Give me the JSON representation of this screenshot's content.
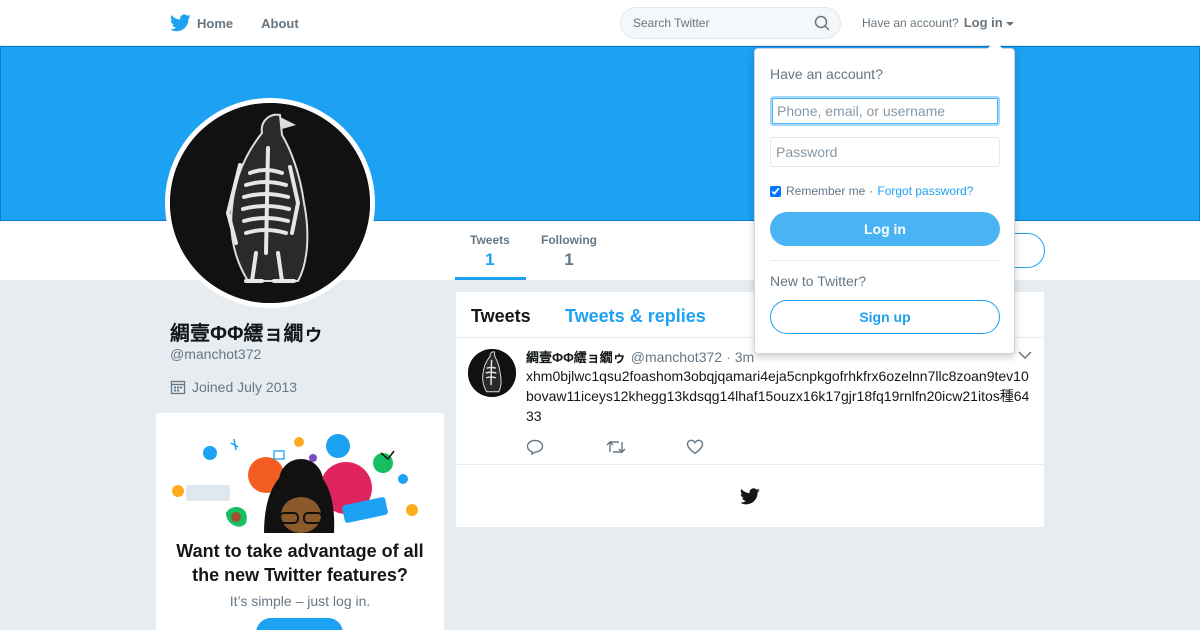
{
  "nav": {
    "home_label": "Home",
    "about_label": "About",
    "search_placeholder": "Search Twitter",
    "account_prompt": "Have an account?",
    "login_label": "Log in"
  },
  "profile": {
    "name": "綢壹ФΦ繧ョ繝ゥ",
    "handle": "@manchot372",
    "joined": "Joined July 2013",
    "stats": [
      {
        "label": "Tweets",
        "value": "1"
      },
      {
        "label": "Following",
        "value": "1"
      }
    ]
  },
  "promo": {
    "title": "Want to take advantage of all the new Twitter features?",
    "subtitle": "It’s simple – just log in."
  },
  "timeline": {
    "tabs": [
      "Tweets",
      "Tweets & replies"
    ],
    "tweet": {
      "name": "綢壹ФΦ繧ョ繝ゥ",
      "handle": "@manchot372",
      "time": "3m",
      "text": "xhm0bjlwc1qsu2foashom3obqjqamari4eja5cnpkgofrhkfrx6ozelnn7llc8zoan9tev10bovaw11iceys12khegg13kdsqg14lhaf15ouzx16k17gjr18fq19rnlfn20icw21itos種6433"
    }
  },
  "login_dropdown": {
    "title": "Have an account?",
    "username_placeholder": "Phone, email, or username",
    "password_placeholder": "Password",
    "remember_label": "Remember me",
    "separator": "·",
    "forgot_label": "Forgot password?",
    "login_button": "Log in",
    "new_prompt": "New to Twitter?",
    "signup_button": "Sign up"
  },
  "colors": {
    "brand": "#1da1f2",
    "background": "#e6ecf0",
    "muted_text": "#657786"
  },
  "icons": [
    "twitter-bird-icon",
    "home-icon",
    "search-icon",
    "caret-down-icon",
    "calendar-icon",
    "reply-icon",
    "retweet-icon",
    "like-icon",
    "chevron-down-icon"
  ]
}
